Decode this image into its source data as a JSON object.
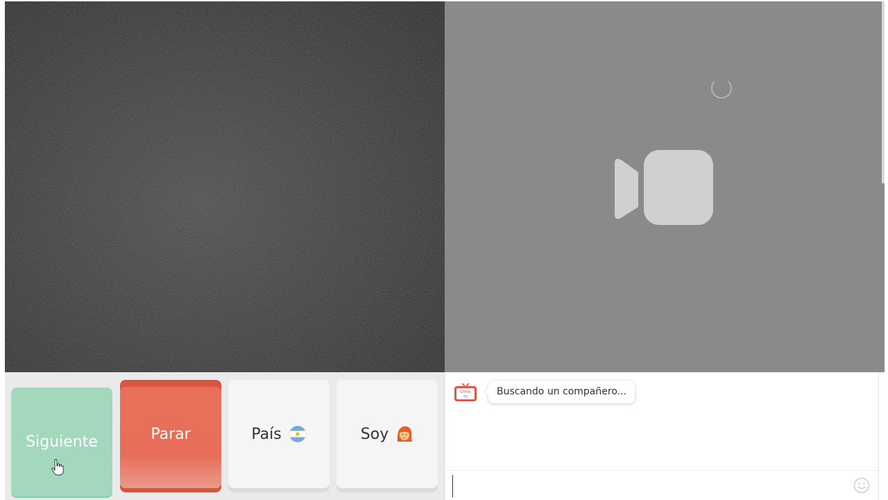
{
  "controls": {
    "next_label": "Siguiente",
    "stop_label": "Parar",
    "country_label": "País",
    "country_flag": "flag-argentina-icon",
    "gender_label": "Soy",
    "gender_emoji": "woman-emoji-icon"
  },
  "chat": {
    "status_message": "Buscando un compañero...",
    "logo": "ome-tv-logo-icon",
    "input_value": "",
    "emoji_button": "smile-icon"
  },
  "colors": {
    "next_button": "#a3d8bd",
    "stop_button": "#e76f59",
    "neutral_button": "#f5f5f5",
    "remote_video_bg": "#8a8a8a"
  }
}
